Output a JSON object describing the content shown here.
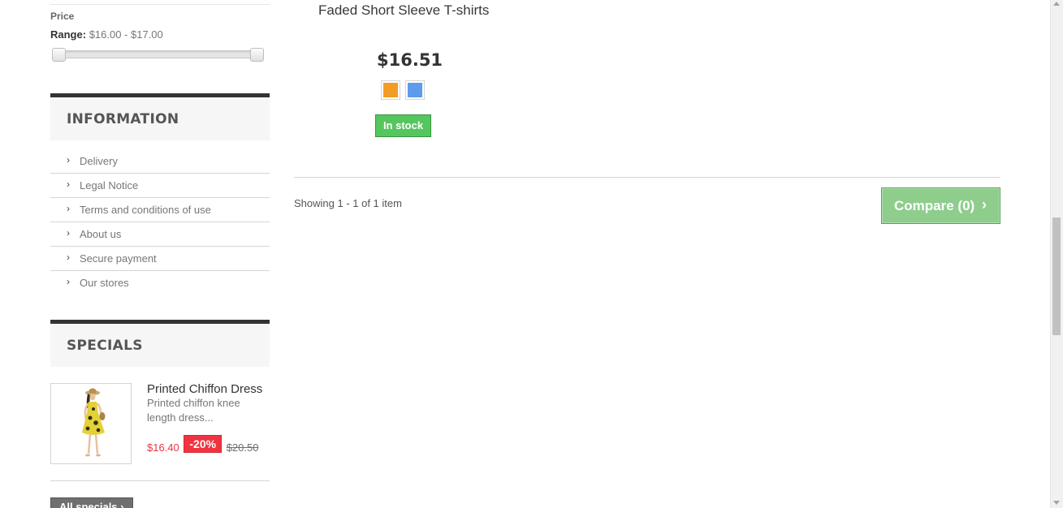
{
  "price_filter": {
    "title": "Price",
    "range_label": "Range:",
    "range_value": "$16.00 - $17.00"
  },
  "information": {
    "title": "INFORMATION",
    "items": [
      {
        "label": "Delivery"
      },
      {
        "label": "Legal Notice"
      },
      {
        "label": "Terms and conditions of use"
      },
      {
        "label": "About us"
      },
      {
        "label": "Secure payment"
      },
      {
        "label": "Our stores"
      }
    ]
  },
  "specials": {
    "title": "SPECIALS",
    "item": {
      "name": "Printed Chiffon Dress",
      "description": "Printed chiffon knee length dress...",
      "price": "$16.40",
      "reduction": "-20%",
      "old_price": "$20.50"
    },
    "all_specials_label": "All specials"
  },
  "product": {
    "name": "Faded Short Sleeve T-shirts",
    "price": "$16.51",
    "color_swatches": [
      {
        "name": "orange",
        "color": "#f39c24"
      },
      {
        "name": "blue",
        "color": "#5d9cec"
      }
    ],
    "availability": "In stock"
  },
  "listing": {
    "showing_text": "Showing 1 - 1 of 1 item",
    "compare_label": "Compare (0)"
  },
  "colors": {
    "accent_green": "#55c65e",
    "compare_green": "#8fcd8d",
    "special_red": "#f13340"
  }
}
